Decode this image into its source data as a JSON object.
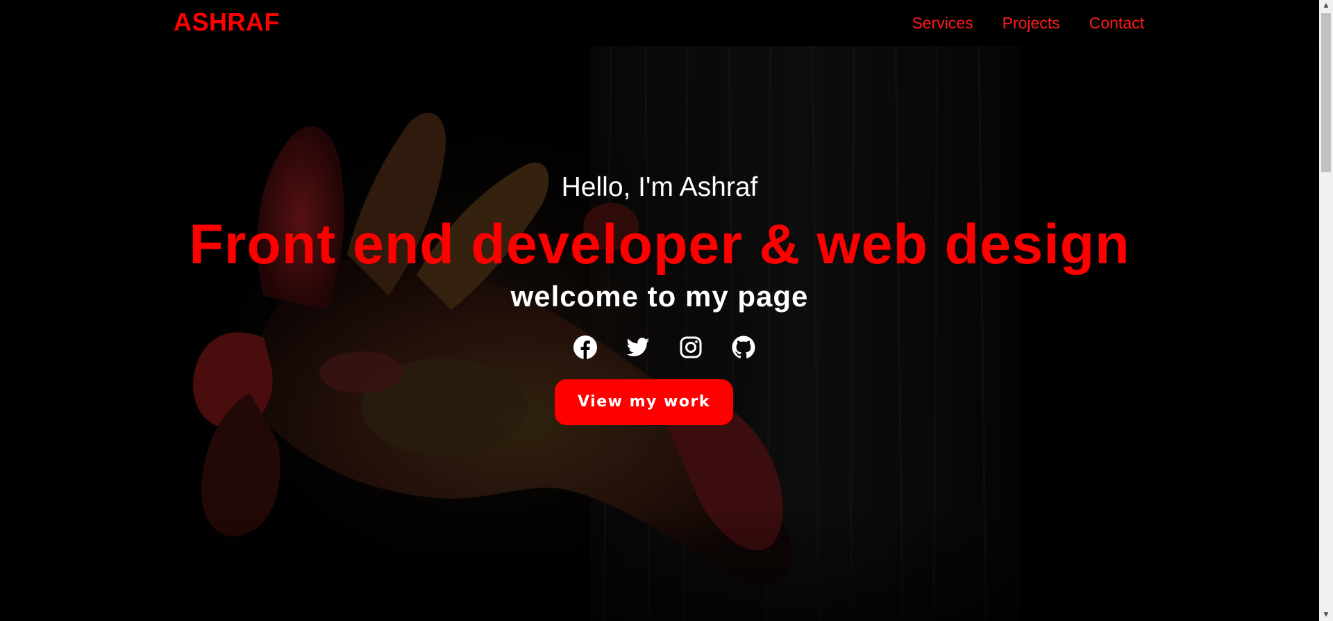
{
  "navbar": {
    "brand": "ASHRAF",
    "links": [
      {
        "label": "Services"
      },
      {
        "label": "Projects"
      },
      {
        "label": "Contact"
      }
    ]
  },
  "hero": {
    "greeting": "Hello, I'm Ashraf",
    "headline": "Front end developer & web design",
    "subline": "welcome to my page",
    "social_icons": [
      "facebook-icon",
      "twitter-icon",
      "instagram-icon",
      "github-icon"
    ],
    "cta_label": "View my work"
  },
  "colors": {
    "accent": "#ff0000",
    "background": "#000000",
    "text": "#ffffff"
  }
}
